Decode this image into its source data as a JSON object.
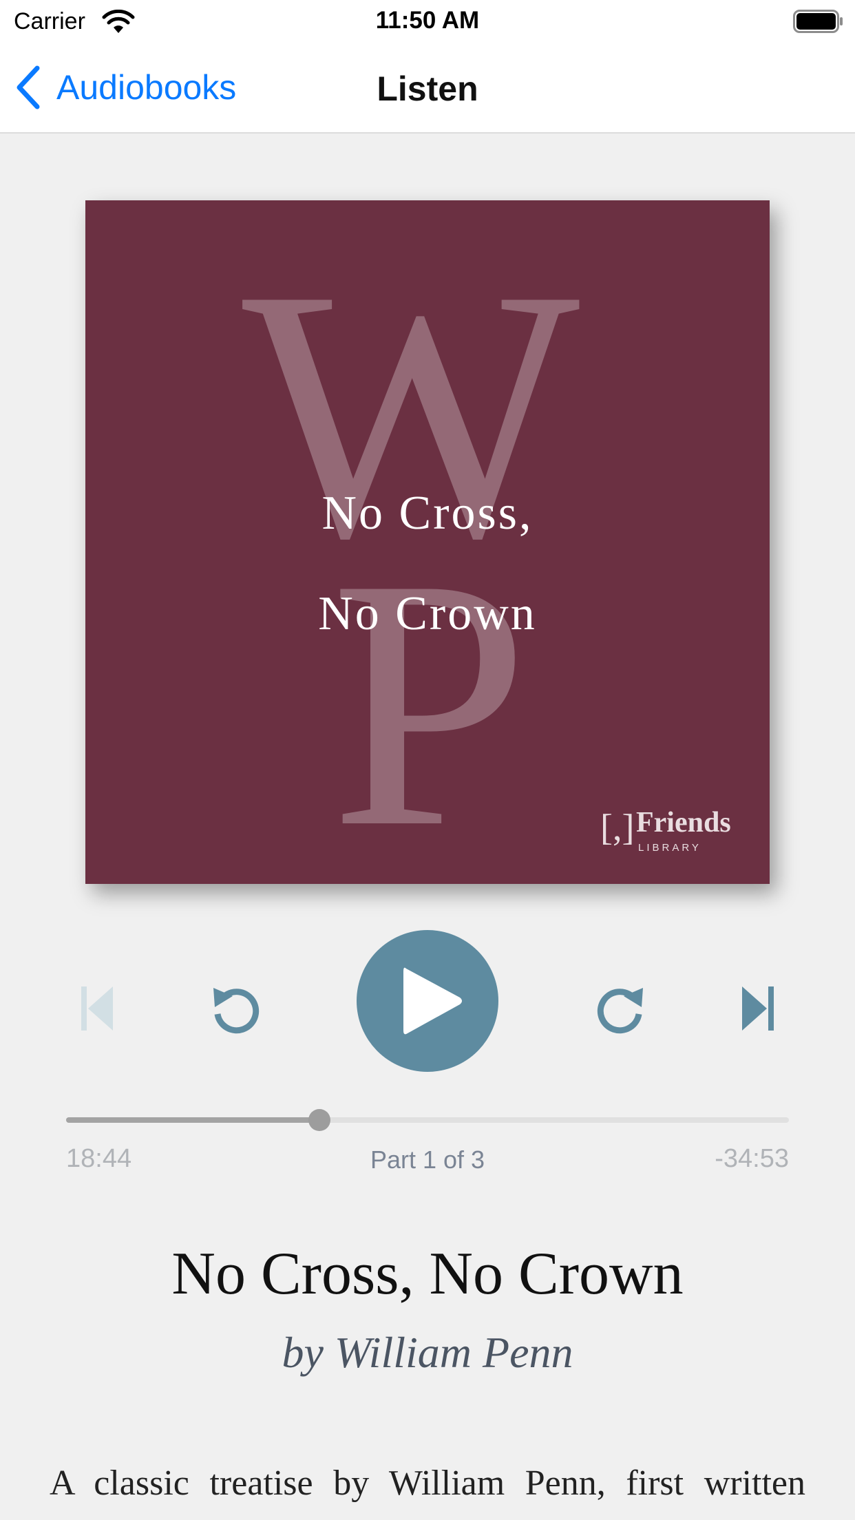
{
  "status_bar": {
    "carrier": "Carrier",
    "time": "11:50 AM"
  },
  "nav": {
    "back_label": "Audiobooks",
    "title": "Listen",
    "accent_color": "#0a7aff"
  },
  "cover": {
    "monogram": "WP",
    "title_line1": "No Cross,",
    "title_line2": "No Crown",
    "logo_mark": "[,]",
    "logo_name": "Friends",
    "logo_sub": "LIBRARY",
    "background_color": "#6b3042"
  },
  "player": {
    "previous_enabled": false,
    "play_color": "#5e8ba0",
    "progress_fraction": 0.35,
    "elapsed": "18:44",
    "part": "Part 1 of 3",
    "remaining": "-34:53"
  },
  "book": {
    "title": "No Cross, No Crown",
    "author": "by William Penn",
    "description": "A classic treatise by William Penn, first written"
  }
}
